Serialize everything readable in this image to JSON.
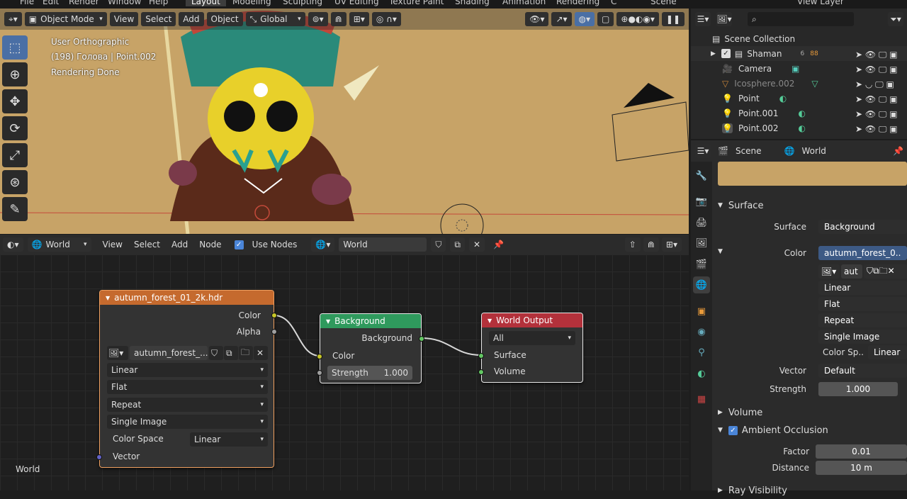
{
  "top_menu": [
    "File",
    "Edit",
    "Render",
    "Window",
    "Help"
  ],
  "workspace_tabs": [
    "Layout",
    "Modeling",
    "Sculpting",
    "UV Editing",
    "Texture Paint",
    "Shading",
    "Animation",
    "Rendering",
    "C"
  ],
  "scene_name": "Scene",
  "view_layer": "View Layer",
  "viewport": {
    "mode": "Object Mode",
    "menus": [
      "View",
      "Select",
      "Add",
      "Object"
    ],
    "orientation": "Global",
    "overlay_lines": [
      "User Orthographic",
      "(198) Голова | Point.002",
      "Rendering Done"
    ]
  },
  "node_editor": {
    "editor_type": "World",
    "menus": [
      "View",
      "Select",
      "Add",
      "Node"
    ],
    "use_nodes_label": "Use Nodes",
    "use_nodes_checked": true,
    "world_name": "World",
    "corner_label": "World",
    "image_node": {
      "title": "autumn_forest_01_2k.hdr",
      "outputs": [
        "Color",
        "Alpha"
      ],
      "image_name": "autumn_forest_...",
      "interpolation": "Linear",
      "projection": "Flat",
      "extension": "Repeat",
      "source": "Single Image",
      "color_space_label": "Color Space",
      "color_space": "Linear",
      "input": "Vector"
    },
    "background_node": {
      "title": "Background",
      "output": "Background",
      "input_color": "Color",
      "strength_label": "Strength",
      "strength_value": "1.000"
    },
    "output_node": {
      "title": "World Output",
      "target": "All",
      "inputs": [
        "Surface",
        "Volume"
      ]
    }
  },
  "outliner": {
    "root": "Scene Collection",
    "items": [
      {
        "name": "Shaman",
        "dim": false
      },
      {
        "name": "Camera",
        "dim": false
      },
      {
        "name": "Icosphere.002",
        "dim": true
      },
      {
        "name": "Point",
        "dim": false
      },
      {
        "name": "Point.001",
        "dim": false
      },
      {
        "name": "Point.002",
        "dim": false
      }
    ],
    "shaman_badges": [
      "6",
      "88"
    ]
  },
  "properties": {
    "breadcrumb": [
      "Scene",
      "World"
    ],
    "surface_section": "Surface",
    "surface_label": "Surface",
    "surface_value": "Background",
    "color_label": "Color",
    "color_value": "autumn_forest_0..",
    "image_short": "aut",
    "interpolation": "Linear",
    "projection": "Flat",
    "extension": "Repeat",
    "source": "Single Image",
    "color_space_label": "Color Sp..",
    "color_space": "Linear",
    "vector_label": "Vector",
    "vector_value": "Default",
    "strength_label": "Strength",
    "strength_value": "1.000",
    "volume_section": "Volume",
    "ao_section": "Ambient Occlusion",
    "factor_label": "Factor",
    "factor_value": "0.01",
    "distance_label": "Distance",
    "distance_value": "10 m",
    "ray_visibility_section": "Ray Visibility"
  },
  "colors": {
    "viewport_bg": "#c7a367",
    "image_node_header": "#c56a2e",
    "background_node_header": "#2f9a5d",
    "output_node_header": "#b3313b",
    "socket_color": "#c7c729",
    "socket_shader": "#63c763",
    "socket_vector": "#6363c7",
    "accent": "#4a85d8"
  }
}
